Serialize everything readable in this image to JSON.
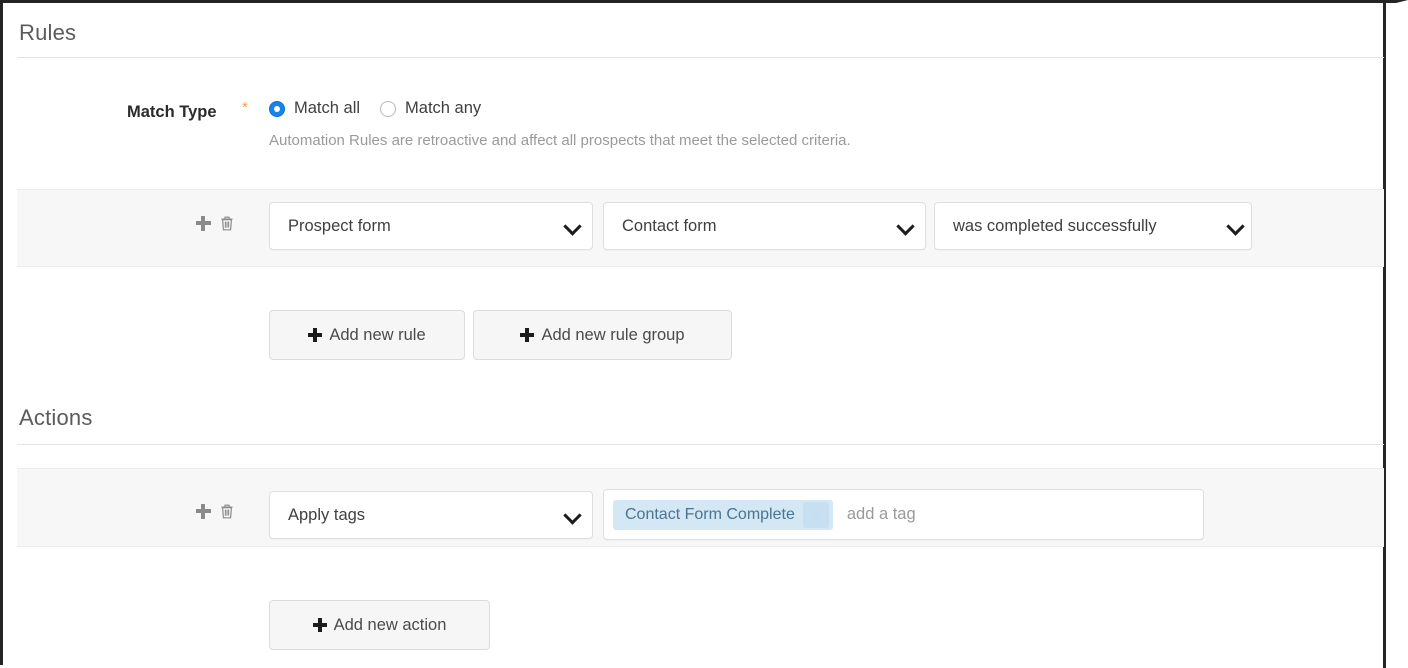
{
  "rules_section": {
    "title": "Rules",
    "match_type": {
      "label": "Match Type",
      "required_marker": "*",
      "options": [
        {
          "label": "Match all",
          "selected": true
        },
        {
          "label": "Match any",
          "selected": false
        }
      ],
      "help_text": "Automation Rules are retroactive and affect all prospects that meet the selected criteria."
    },
    "rule_row": {
      "add_icon": "plus-icon",
      "delete_icon": "trash-icon",
      "selects": [
        {
          "name": "rule-type",
          "value": "Prospect form"
        },
        {
          "name": "rule-object",
          "value": "Contact form"
        },
        {
          "name": "rule-criteria",
          "value": "was completed successfully"
        }
      ]
    },
    "buttons": [
      {
        "name": "add-new-rule",
        "label": "Add new rule"
      },
      {
        "name": "add-new-rule-group",
        "label": "Add new rule group"
      }
    ]
  },
  "actions_section": {
    "title": "Actions",
    "action_row": {
      "add_icon": "plus-icon",
      "delete_icon": "trash-icon",
      "select": {
        "name": "action-type",
        "value": "Apply tags"
      },
      "tag_field": {
        "tags": [
          {
            "label": "Contact Form Complete",
            "remove_icon": "close-icon"
          }
        ],
        "placeholder": "add a tag"
      }
    },
    "buttons": [
      {
        "name": "add-new-action",
        "label": "Add new action"
      }
    ]
  },
  "colors": {
    "accent_blue": "#1784e8",
    "required_orange": "#f2a23c",
    "tag_blue_bg": "#d3e7f5",
    "tag_blue_text": "#4c7390",
    "row_band": "#f7f7f8",
    "frame": "#242424"
  }
}
